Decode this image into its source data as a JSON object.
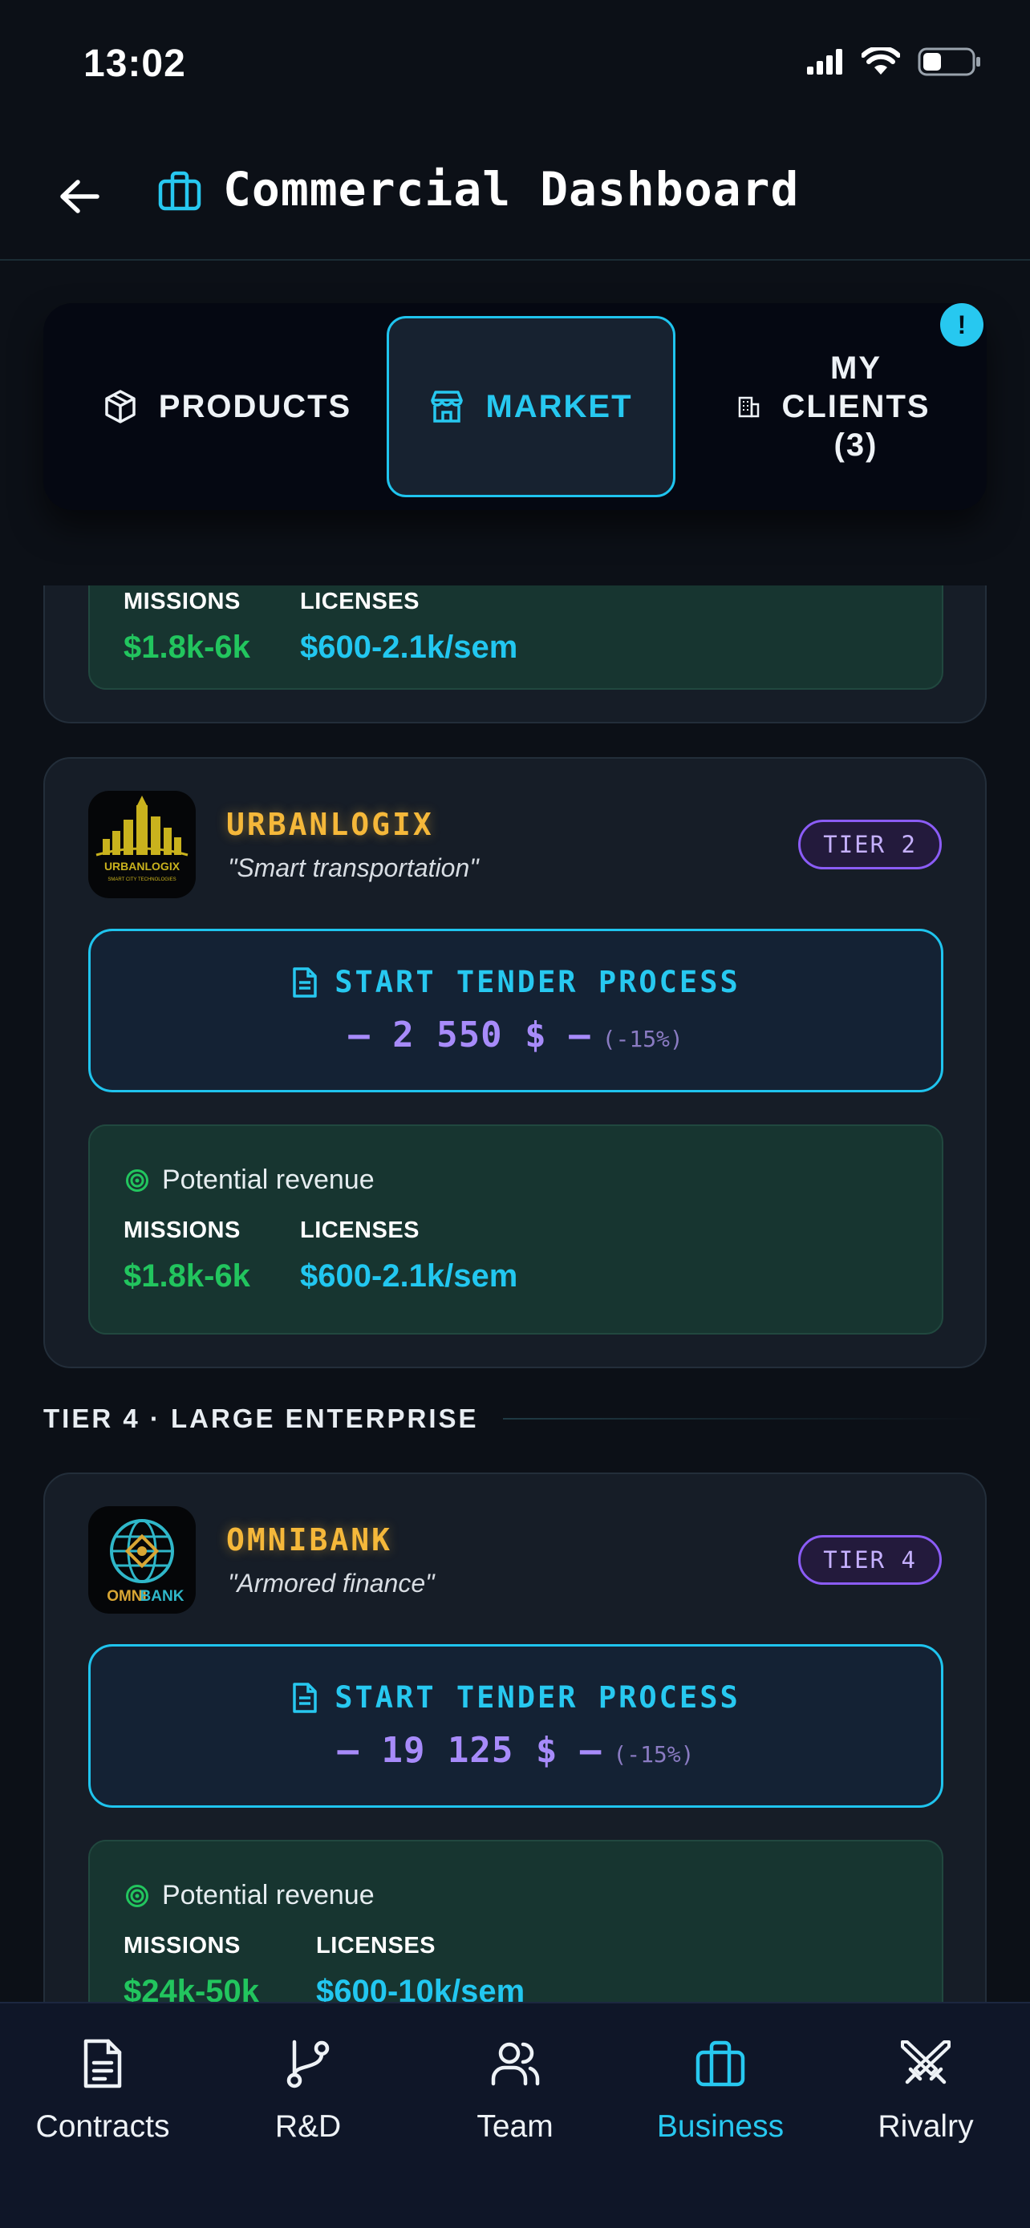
{
  "status_bar": {
    "time": "13:02"
  },
  "header": {
    "title": "Commercial Dashboard"
  },
  "tabs": [
    {
      "label": "PRODUCTS",
      "icon": "cube-icon",
      "active": false
    },
    {
      "label": "MARKET",
      "icon": "store-icon",
      "active": true
    },
    {
      "label_line1": "MY",
      "label_line2": "CLIENTS",
      "label_line3": "(3)",
      "icon": "building-icon",
      "active": false,
      "badge": "!"
    }
  ],
  "partial_card": {
    "missions_label": "MISSIONS",
    "licenses_label": "LICENSES",
    "missions_value": "$1.8k-6k",
    "licenses_value": "$600-2.1k/sem"
  },
  "cards": [
    {
      "name": "URBANLOGIX",
      "tagline": "\"Smart transportation\"",
      "tier": "TIER 2",
      "logo_text": "URBANLOGIX",
      "logo_sub": "SMART CITY TECHNOLOGIES",
      "tender_label": "START TENDER PROCESS",
      "tender_price": "— 2 550 $ —",
      "tender_discount": "(-15%)",
      "revenue_title": "Potential revenue",
      "missions_label": "MISSIONS",
      "missions_value": "$1.8k-6k",
      "licenses_label": "LICENSES",
      "licenses_value": "$600-2.1k/sem"
    },
    {
      "name": "OMNIBANK",
      "tagline": "\"Armored finance\"",
      "tier": "TIER 4",
      "logo_text_a": "OMNI",
      "logo_text_b": "BANK",
      "tender_label": "START TENDER PROCESS",
      "tender_price": "— 19 125 $ —",
      "tender_discount": "(-15%)",
      "revenue_title": "Potential revenue",
      "missions_label": "MISSIONS",
      "missions_value": "$24k-50k",
      "licenses_label": "LICENSES",
      "licenses_value": "$600-10k/sem"
    }
  ],
  "section": {
    "title": "TIER 4 · LARGE ENTERPRISE"
  },
  "bottom_nav": [
    {
      "label": "Contracts",
      "icon": "document-icon",
      "active": false
    },
    {
      "label": "R&D",
      "icon": "git-branch-icon",
      "active": false
    },
    {
      "label": "Team",
      "icon": "users-icon",
      "active": false
    },
    {
      "label": "Business",
      "icon": "briefcase-icon",
      "active": true
    },
    {
      "label": "Rivalry",
      "icon": "crossed-swords-icon",
      "active": false
    }
  ],
  "colors": {
    "accent": "#27c8f0",
    "gold": "#f5b83a",
    "purple": "#a78bfa",
    "green": "#22c55e",
    "background": "#0c1017"
  }
}
